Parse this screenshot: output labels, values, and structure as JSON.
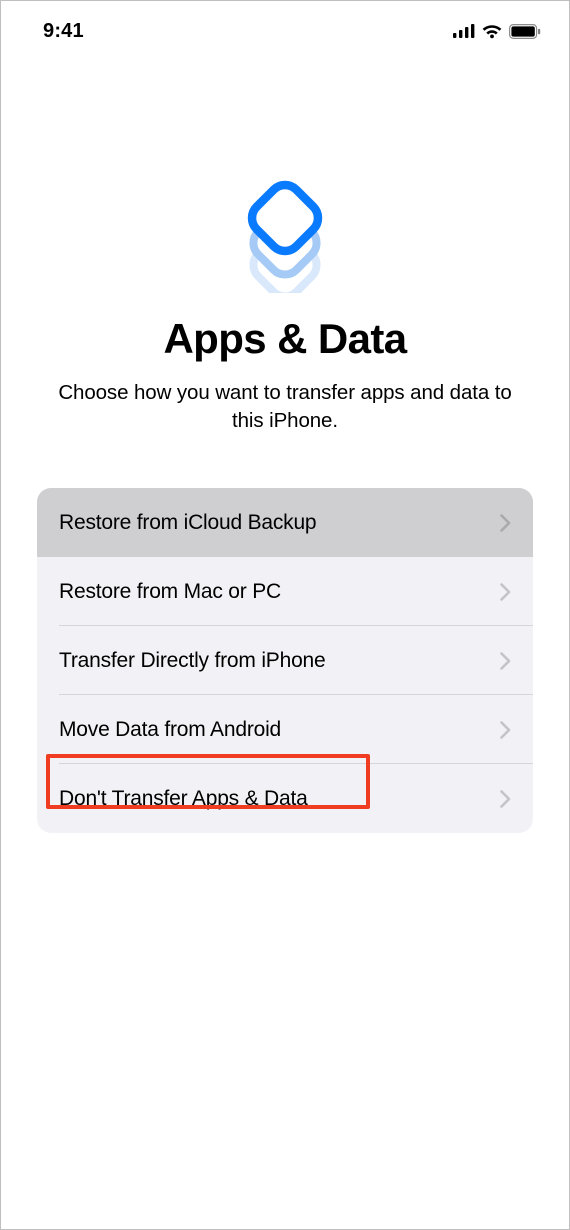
{
  "status": {
    "time": "9:41"
  },
  "hero": {
    "title": "Apps & Data",
    "subtitle": "Choose how you want to transfer apps and data to this iPhone."
  },
  "options": [
    {
      "label": "Restore from iCloud Backup",
      "pressed": true
    },
    {
      "label": "Restore from Mac or PC",
      "pressed": false
    },
    {
      "label": "Transfer Directly from iPhone",
      "pressed": false
    },
    {
      "label": "Move Data from Android",
      "pressed": false,
      "highlighted": true
    },
    {
      "label": "Don't Transfer Apps & Data",
      "pressed": false
    }
  ],
  "colors": {
    "accent": "#0a7bff",
    "highlight": "#f03d22"
  }
}
